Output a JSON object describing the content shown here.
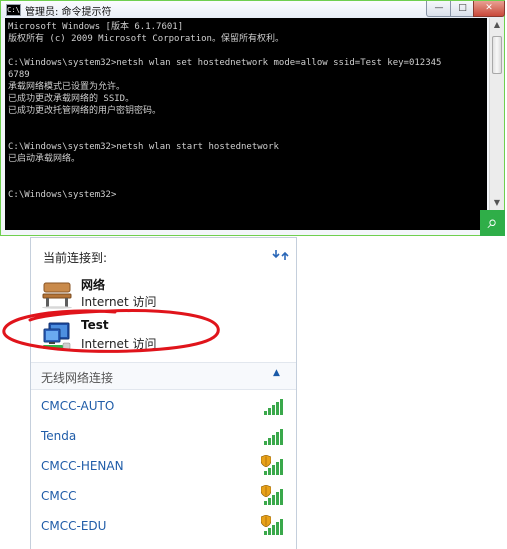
{
  "cmd": {
    "icon_text": "C:\\",
    "title": "管理员: 命令提示符",
    "lines": [
      "Microsoft Windows [版本 6.1.7601]",
      "版权所有 (c) 2009 Microsoft Corporation。保留所有权利。",
      "",
      "C:\\Windows\\system32>netsh wlan set hostednetwork mode=allow ssid=Test key=012345",
      "6789",
      "承载网络模式已设置为允许。",
      "已成功更改承载网络的 SSID。",
      "已成功更改托管网络的用户密钥密码。",
      "",
      "",
      "C:\\Windows\\system32>netsh wlan start hostednetwork",
      "已启动承载网络。",
      "",
      "",
      "C:\\Windows\\system32>"
    ],
    "buttons": {
      "minimize": "—",
      "maximize": "□",
      "close": "✕"
    },
    "scroll_up": "▲",
    "scroll_down": "▼",
    "zoom_glyph": "⌕"
  },
  "network": {
    "heading": "当前连接到:",
    "connections": [
      {
        "name": "网络",
        "status": "Internet 访问",
        "icon": "bench-network-icon"
      },
      {
        "name": "Test",
        "status": "Internet 访问",
        "icon": "computer-network-icon"
      }
    ],
    "wireless_section": {
      "label": "无线网络连接",
      "collapse_glyph": "▲"
    },
    "wifi_networks": [
      {
        "name": "CMCC-AUTO",
        "secured": false
      },
      {
        "name": "Tenda",
        "secured": false
      },
      {
        "name": "CMCC-HENAN",
        "secured": true
      },
      {
        "name": "CMCC",
        "secured": true
      },
      {
        "name": "CMCC-EDU",
        "secured": true
      }
    ],
    "annotation_color": "#e0141b",
    "link_color": "#1f5ca8"
  }
}
